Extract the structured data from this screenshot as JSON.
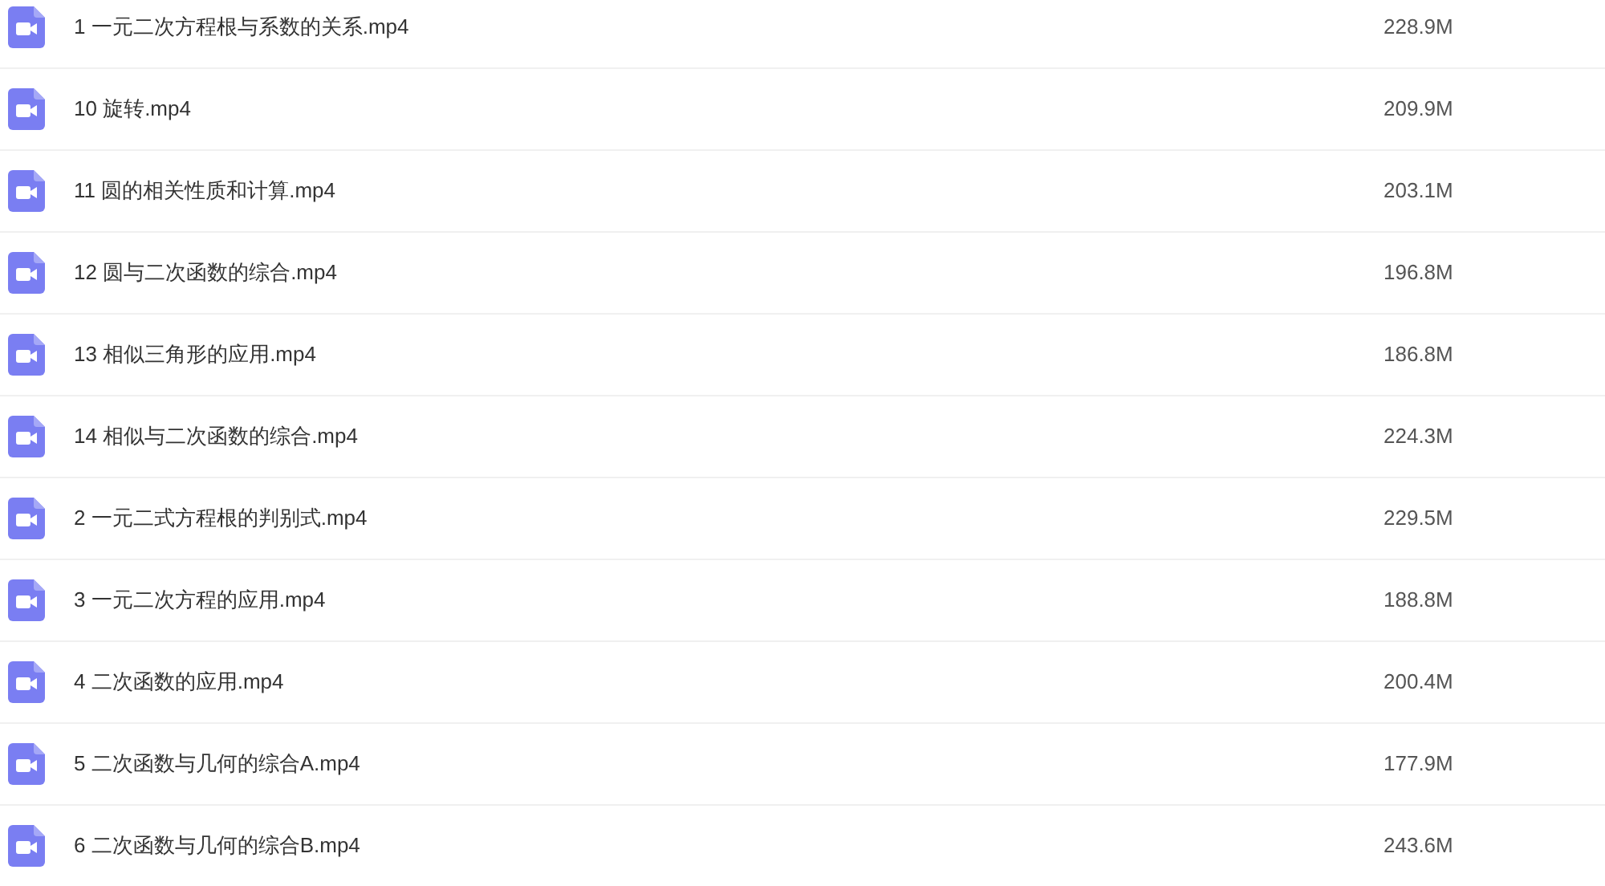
{
  "files": [
    {
      "name": "1 一元二次方程根与系数的关系.mp4",
      "size": "228.9M"
    },
    {
      "name": "10 旋转.mp4",
      "size": "209.9M"
    },
    {
      "name": "11 圆的相关性质和计算.mp4",
      "size": "203.1M"
    },
    {
      "name": "12 圆与二次函数的综合.mp4",
      "size": "196.8M"
    },
    {
      "name": "13 相似三角形的应用.mp4",
      "size": "186.8M"
    },
    {
      "name": "14 相似与二次函数的综合.mp4",
      "size": "224.3M"
    },
    {
      "name": "2 一元二式方程根的判别式.mp4",
      "size": "229.5M"
    },
    {
      "name": "3 一元二次方程的应用.mp4",
      "size": "188.8M"
    },
    {
      "name": "4 二次函数的应用.mp4",
      "size": "200.4M"
    },
    {
      "name": "5 二次函数与几何的综合A.mp4",
      "size": "177.9M"
    },
    {
      "name": "6 二次函数与几何的综合B.mp4",
      "size": "243.6M"
    }
  ]
}
